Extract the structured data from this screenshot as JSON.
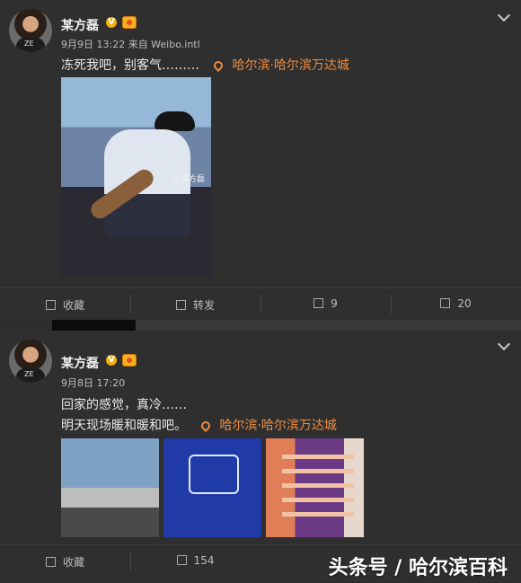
{
  "posts": [
    {
      "author": "某方磊",
      "meta": "9月9日 13:22 来自 Weibo.intl",
      "text_lines": [
        "冻死我吧，别客气………"
      ],
      "location": "哈尔滨·哈尔滨万达城",
      "photo_watermark": "@某方磊",
      "actions": {
        "favorite_label": "收藏",
        "repost_label": "转发",
        "comments_count": "9",
        "likes_count": "20"
      }
    },
    {
      "author": "某方磊",
      "meta": "9月8日 17:20",
      "text_lines": [
        "回家的感觉，真冷……",
        "明天现场暖和暖和吧。"
      ],
      "location": "哈尔滨·哈尔滨万达城",
      "actions": {
        "favorite_label": "收藏",
        "repost_count": "154"
      }
    }
  ],
  "avatar_shirt_text": "ZE",
  "watermark": "头条号 / 哈尔滨百科",
  "colors": {
    "background": "#2f2f2f",
    "location": "#f18b3f",
    "badge": "#f0b10f"
  }
}
